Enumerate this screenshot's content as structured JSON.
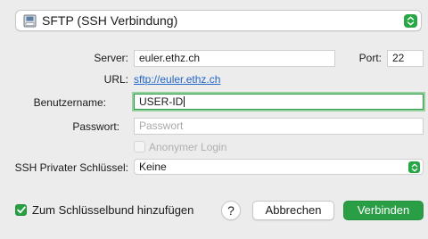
{
  "protocol": {
    "selected": "SFTP (SSH Verbindung)",
    "icon": "disk-icon"
  },
  "server": {
    "label": "Server:",
    "value": "euler.ethz.ch"
  },
  "port": {
    "label": "Port:",
    "value": "22"
  },
  "url": {
    "label": "URL:",
    "value": "sftp://euler.ethz.ch"
  },
  "username": {
    "label": "Benutzername:",
    "value": "USER-ID"
  },
  "password": {
    "label": "Passwort:",
    "placeholder": "Passwort"
  },
  "anonymous": {
    "label": "Anonymer Login",
    "checked": false
  },
  "ssh_key": {
    "label": "SSH Privater Schlüssel:",
    "selected": "Keine"
  },
  "keychain": {
    "label": "Zum Schlüsselbund hinzufügen",
    "checked": true
  },
  "help": {
    "label": "?"
  },
  "buttons": {
    "cancel": "Abbrechen",
    "connect": "Verbinden"
  },
  "colors": {
    "accent": "#2a9e45",
    "link": "#2366c7",
    "focus_ring": "#95d09f"
  }
}
